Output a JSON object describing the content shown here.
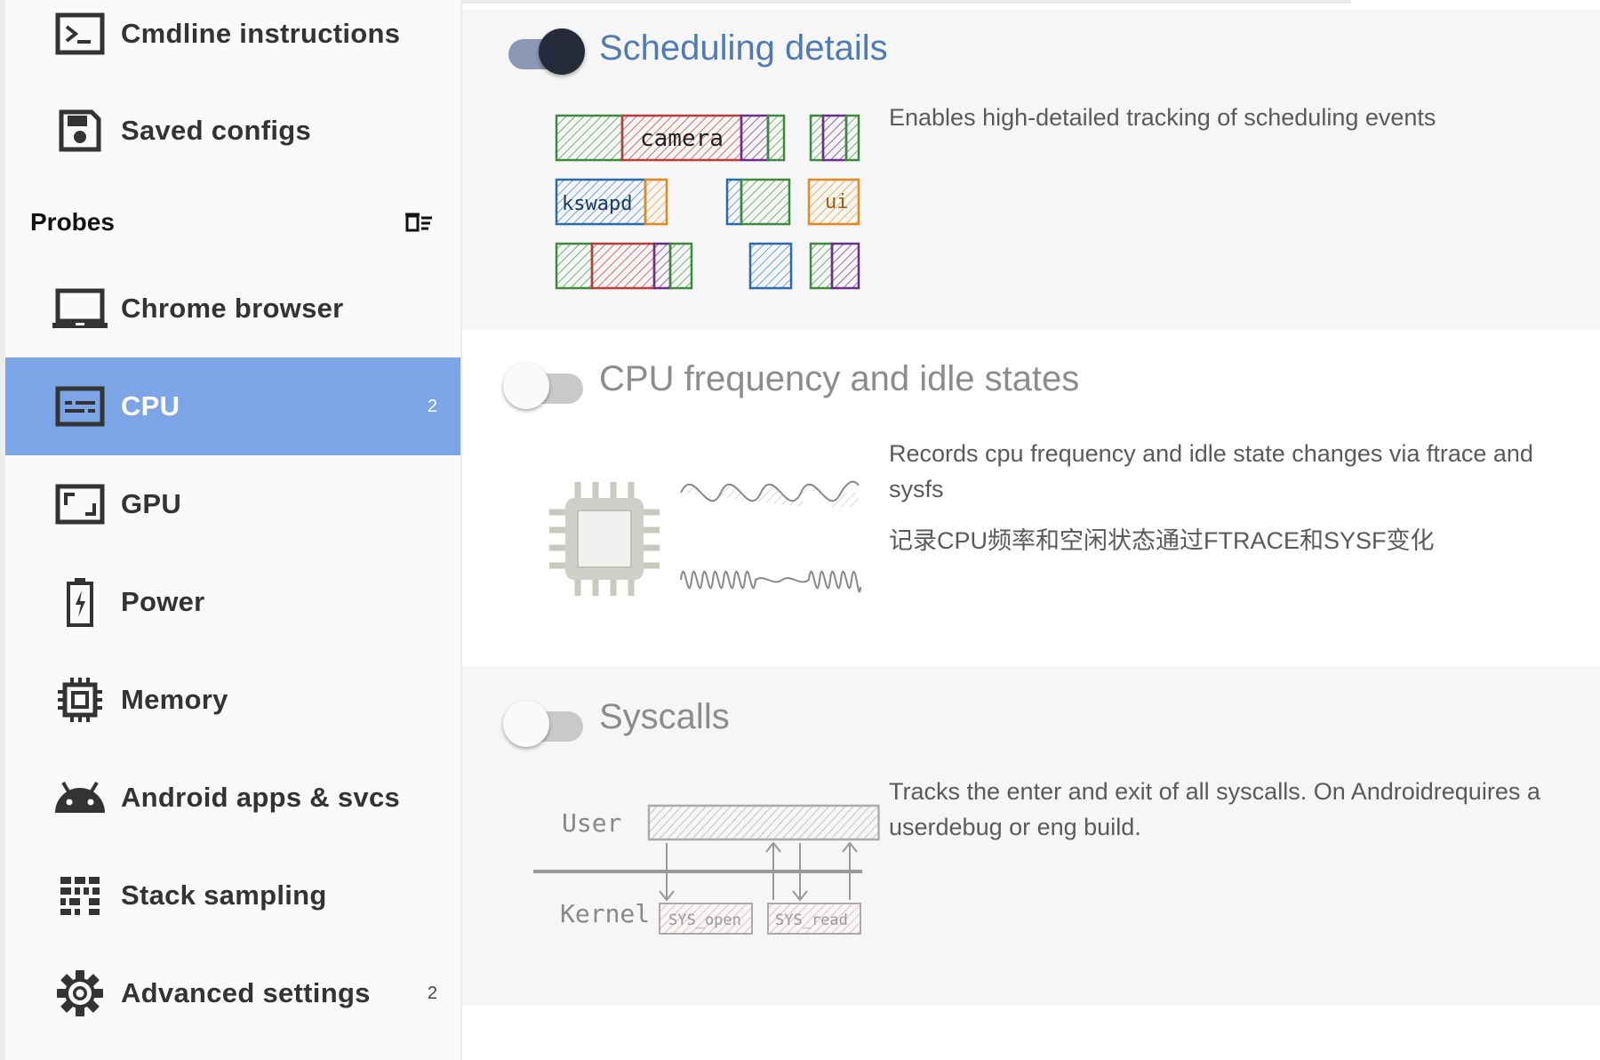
{
  "sidebar": {
    "items_top": [
      {
        "label": "Cmdline instructions",
        "icon": "terminal-icon"
      },
      {
        "label": "Saved configs",
        "icon": "save-icon"
      }
    ],
    "section_title": "Probes",
    "section_action_icon": "clear-all-icon",
    "probes": [
      {
        "label": "Chrome browser",
        "icon": "laptop-icon",
        "count": ""
      },
      {
        "label": "CPU",
        "icon": "cpu-card-icon",
        "count": "2",
        "selected": true
      },
      {
        "label": "GPU",
        "icon": "gpu-aspect-icon",
        "count": ""
      },
      {
        "label": "Power",
        "icon": "battery-charging-icon",
        "count": ""
      },
      {
        "label": "Memory",
        "icon": "memory-chip-icon",
        "count": ""
      },
      {
        "label": "Android apps & svcs",
        "icon": "android-icon",
        "count": ""
      },
      {
        "label": "Stack sampling",
        "icon": "grid-icon",
        "count": ""
      },
      {
        "label": "Advanced settings",
        "icon": "gear-icon",
        "count": "2"
      }
    ],
    "accent_color": "#7ba5e6"
  },
  "main": {
    "probes": [
      {
        "title": "Scheduling details",
        "enabled": true,
        "description": [
          "Enables high-detailed tracking of scheduling events"
        ],
        "illustration_labels": [
          "camera",
          "kswapd",
          "ui"
        ]
      },
      {
        "title": "CPU frequency and idle states",
        "enabled": false,
        "description": [
          "Records cpu frequency and idle state changes via ftrace and sysfs",
          "记录CPU频率和空闲状态通过FTRACE和SYSF变化"
        ]
      },
      {
        "title": "Syscalls",
        "enabled": false,
        "description": [
          "Tracks the enter and exit of all syscalls. On Androidrequires a userdebug or eng build."
        ],
        "illustration_labels": [
          "User",
          "Kernel",
          "SYS_open",
          "SYS_read"
        ]
      }
    ],
    "title_active_color": "#4f7ab8",
    "title_inactive_color": "#8c8c8c"
  }
}
